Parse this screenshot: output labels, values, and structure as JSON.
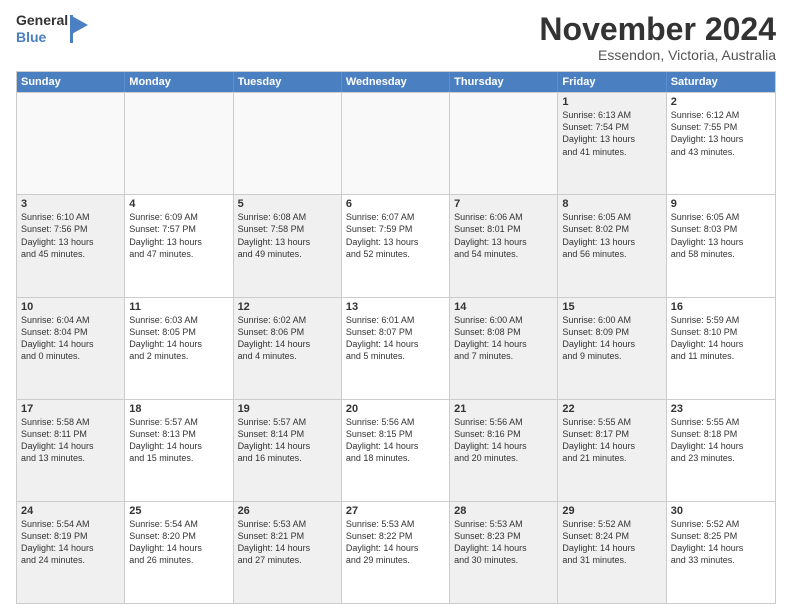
{
  "logo": {
    "line1": "General",
    "line2": "Blue"
  },
  "title": "November 2024",
  "location": "Essendon, Victoria, Australia",
  "dayHeaders": [
    "Sunday",
    "Monday",
    "Tuesday",
    "Wednesday",
    "Thursday",
    "Friday",
    "Saturday"
  ],
  "weeks": [
    [
      {
        "num": "",
        "info": "",
        "empty": true
      },
      {
        "num": "",
        "info": "",
        "empty": true
      },
      {
        "num": "",
        "info": "",
        "empty": true
      },
      {
        "num": "",
        "info": "",
        "empty": true
      },
      {
        "num": "",
        "info": "",
        "empty": true
      },
      {
        "num": "1",
        "info": "Sunrise: 6:13 AM\nSunset: 7:54 PM\nDaylight: 13 hours\nand 41 minutes.",
        "shaded": true
      },
      {
        "num": "2",
        "info": "Sunrise: 6:12 AM\nSunset: 7:55 PM\nDaylight: 13 hours\nand 43 minutes."
      }
    ],
    [
      {
        "num": "3",
        "info": "Sunrise: 6:10 AM\nSunset: 7:56 PM\nDaylight: 13 hours\nand 45 minutes.",
        "shaded": true
      },
      {
        "num": "4",
        "info": "Sunrise: 6:09 AM\nSunset: 7:57 PM\nDaylight: 13 hours\nand 47 minutes."
      },
      {
        "num": "5",
        "info": "Sunrise: 6:08 AM\nSunset: 7:58 PM\nDaylight: 13 hours\nand 49 minutes.",
        "shaded": true
      },
      {
        "num": "6",
        "info": "Sunrise: 6:07 AM\nSunset: 7:59 PM\nDaylight: 13 hours\nand 52 minutes."
      },
      {
        "num": "7",
        "info": "Sunrise: 6:06 AM\nSunset: 8:01 PM\nDaylight: 13 hours\nand 54 minutes.",
        "shaded": true
      },
      {
        "num": "8",
        "info": "Sunrise: 6:05 AM\nSunset: 8:02 PM\nDaylight: 13 hours\nand 56 minutes.",
        "shaded": true
      },
      {
        "num": "9",
        "info": "Sunrise: 6:05 AM\nSunset: 8:03 PM\nDaylight: 13 hours\nand 58 minutes."
      }
    ],
    [
      {
        "num": "10",
        "info": "Sunrise: 6:04 AM\nSunset: 8:04 PM\nDaylight: 14 hours\nand 0 minutes.",
        "shaded": true
      },
      {
        "num": "11",
        "info": "Sunrise: 6:03 AM\nSunset: 8:05 PM\nDaylight: 14 hours\nand 2 minutes."
      },
      {
        "num": "12",
        "info": "Sunrise: 6:02 AM\nSunset: 8:06 PM\nDaylight: 14 hours\nand 4 minutes.",
        "shaded": true
      },
      {
        "num": "13",
        "info": "Sunrise: 6:01 AM\nSunset: 8:07 PM\nDaylight: 14 hours\nand 5 minutes."
      },
      {
        "num": "14",
        "info": "Sunrise: 6:00 AM\nSunset: 8:08 PM\nDaylight: 14 hours\nand 7 minutes.",
        "shaded": true
      },
      {
        "num": "15",
        "info": "Sunrise: 6:00 AM\nSunset: 8:09 PM\nDaylight: 14 hours\nand 9 minutes.",
        "shaded": true
      },
      {
        "num": "16",
        "info": "Sunrise: 5:59 AM\nSunset: 8:10 PM\nDaylight: 14 hours\nand 11 minutes."
      }
    ],
    [
      {
        "num": "17",
        "info": "Sunrise: 5:58 AM\nSunset: 8:11 PM\nDaylight: 14 hours\nand 13 minutes.",
        "shaded": true
      },
      {
        "num": "18",
        "info": "Sunrise: 5:57 AM\nSunset: 8:13 PM\nDaylight: 14 hours\nand 15 minutes."
      },
      {
        "num": "19",
        "info": "Sunrise: 5:57 AM\nSunset: 8:14 PM\nDaylight: 14 hours\nand 16 minutes.",
        "shaded": true
      },
      {
        "num": "20",
        "info": "Sunrise: 5:56 AM\nSunset: 8:15 PM\nDaylight: 14 hours\nand 18 minutes."
      },
      {
        "num": "21",
        "info": "Sunrise: 5:56 AM\nSunset: 8:16 PM\nDaylight: 14 hours\nand 20 minutes.",
        "shaded": true
      },
      {
        "num": "22",
        "info": "Sunrise: 5:55 AM\nSunset: 8:17 PM\nDaylight: 14 hours\nand 21 minutes.",
        "shaded": true
      },
      {
        "num": "23",
        "info": "Sunrise: 5:55 AM\nSunset: 8:18 PM\nDaylight: 14 hours\nand 23 minutes."
      }
    ],
    [
      {
        "num": "24",
        "info": "Sunrise: 5:54 AM\nSunset: 8:19 PM\nDaylight: 14 hours\nand 24 minutes.",
        "shaded": true
      },
      {
        "num": "25",
        "info": "Sunrise: 5:54 AM\nSunset: 8:20 PM\nDaylight: 14 hours\nand 26 minutes."
      },
      {
        "num": "26",
        "info": "Sunrise: 5:53 AM\nSunset: 8:21 PM\nDaylight: 14 hours\nand 27 minutes.",
        "shaded": true
      },
      {
        "num": "27",
        "info": "Sunrise: 5:53 AM\nSunset: 8:22 PM\nDaylight: 14 hours\nand 29 minutes."
      },
      {
        "num": "28",
        "info": "Sunrise: 5:53 AM\nSunset: 8:23 PM\nDaylight: 14 hours\nand 30 minutes.",
        "shaded": true
      },
      {
        "num": "29",
        "info": "Sunrise: 5:52 AM\nSunset: 8:24 PM\nDaylight: 14 hours\nand 31 minutes.",
        "shaded": true
      },
      {
        "num": "30",
        "info": "Sunrise: 5:52 AM\nSunset: 8:25 PM\nDaylight: 14 hours\nand 33 minutes."
      }
    ]
  ]
}
